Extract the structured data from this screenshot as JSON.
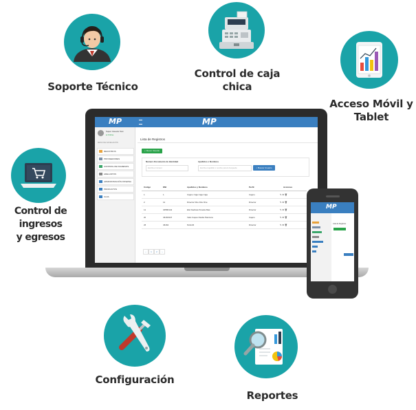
{
  "features": {
    "soporte": {
      "label": "Soporte Técnico",
      "icon": "support-agent-icon"
    },
    "caja": {
      "line1": "Control de caja",
      "line2": "chica",
      "icon": "cash-register-icon"
    },
    "movil": {
      "line1": "Acceso Móvil y",
      "line2": "Tablet",
      "icon": "tablet-chart-icon"
    },
    "ingresos": {
      "line1": "Control de ingresos",
      "line2": "y egresos",
      "icon": "laptop-cart-icon"
    },
    "config": {
      "label": "Configuración",
      "icon": "tools-icon"
    },
    "reportes": {
      "label": "Reportes",
      "icon": "report-magnifier-icon"
    }
  },
  "colors": {
    "circle": "#1aa3a8",
    "appbar": "#3a7fc0",
    "green_button": "#2aa34a",
    "blue_button": "#3a7fc0"
  },
  "app": {
    "logo": "MP",
    "user_name": "Super Usuario Test",
    "user_status": "Online",
    "nav_header": "MENU DE NAVEGACIÓN",
    "menu": [
      {
        "label": "REGISTROS",
        "color": "#e8a23a"
      },
      {
        "label": "PROVEEDORES",
        "color": "#7b8fa6"
      },
      {
        "label": "CONTROL DE INGRESOS",
        "color": "#3aa66a"
      },
      {
        "label": "ADELANTOS",
        "color": "#888888"
      },
      {
        "label": "ADMINISTRACIÓN INTERNA",
        "color": "#3a7fc0"
      },
      {
        "label": "PRODUCTOS",
        "color": "#3a7fc0"
      },
      {
        "label": "CAJA",
        "color": "#3a7fc0"
      }
    ],
    "page_title": "Lista de Registros",
    "new_button": "+ Nuevo Usuario",
    "filter_doc_label": "Numero Documento de Identidad",
    "filter_doc_placeholder": "Escriba el número",
    "filter_name_label": "Apellidos o Nombres",
    "filter_name_placeholder": "Escriba el apellido o nombre para la busqueda",
    "search_button": "Buscar Usuario",
    "columns": [
      "Código",
      "DNI",
      "Apellidos y Nombres",
      "Perfil",
      "Acciones"
    ],
    "rows": [
      {
        "code": "1",
        "dni": "1",
        "name": "Cajero Caja Caja Caja",
        "perfil": "Cajero"
      },
      {
        "code": "2",
        "dni": "12",
        "name": "Director Dire Dire Dire",
        "perfil": "Director"
      },
      {
        "code": "11",
        "dni": "40580142",
        "name": "Elsi Dedicas Pereda Mas",
        "perfil": "Director"
      },
      {
        "code": "20",
        "dni": "46163347",
        "name": "Velsi Capes Davila Panciera",
        "perfil": "Cajero"
      },
      {
        "code": "26",
        "dni": "46162",
        "name": "Nini123",
        "perfil": "Director"
      }
    ],
    "pagination": [
      "‹",
      "1",
      "2",
      "›"
    ],
    "phone_title": "Lista de Registros"
  }
}
